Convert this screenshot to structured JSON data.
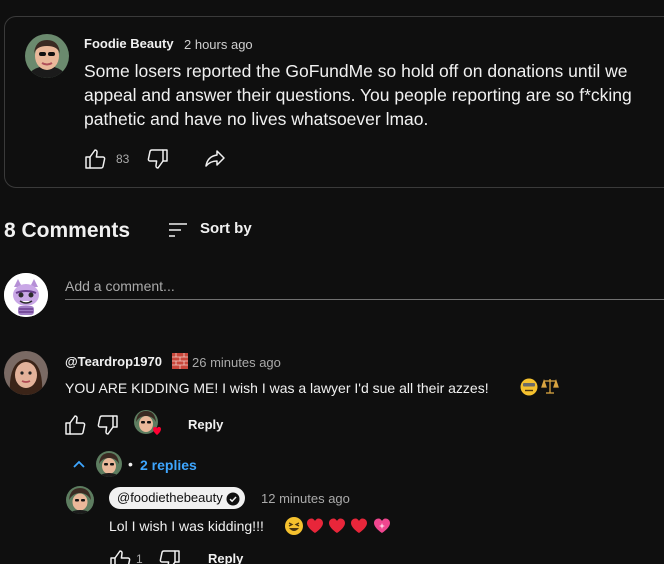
{
  "post": {
    "author": "Foodie Beauty",
    "time": "2 hours ago",
    "text": "Some losers reported the GoFundMe so hold off on donations until we appeal and answer their questions. You people reporting are so f*cking pathetic and have no lives whatsoever lmao.",
    "like_count": "83",
    "icons": {
      "like": "thumbs-up-icon",
      "dislike": "thumbs-down-icon",
      "share": "share-icon"
    }
  },
  "comments_section": {
    "count_label": "8 Comments",
    "sort_label": "Sort by",
    "add_comment_placeholder": "Add a comment..."
  },
  "comments": [
    {
      "author": "@Teardrop1970",
      "author_badge_icon": "brick-wall-emoji",
      "time": "26 minutes ago",
      "text": "YOU ARE KIDDING ME! I wish I was a lawyer I'd sue all their azzes!",
      "trailing_emojis": [
        "dizzy-face-emoji",
        "balance-scale-emoji"
      ],
      "reply_label": "Reply",
      "creator_heart": true,
      "replies_toggle": {
        "dot": "•",
        "label": "2 replies"
      },
      "replies": [
        {
          "author": "@foodiethebeauty",
          "verified": true,
          "time": "12 minutes ago",
          "text": "Lol I wish I was kidding!!!",
          "trailing_emojis": [
            "grinning-squinting-face-emoji",
            "red-heart-emoji",
            "red-heart-emoji",
            "red-heart-emoji",
            "sparkling-heart-emoji"
          ],
          "like_count": "1",
          "reply_label": "Reply"
        }
      ]
    }
  ],
  "colors": {
    "background": "#0f0f0f",
    "text": "#f1f1f1",
    "secondary_text": "#aaaaaa",
    "link": "#3ea6ff",
    "border": "#3a3a3a"
  }
}
